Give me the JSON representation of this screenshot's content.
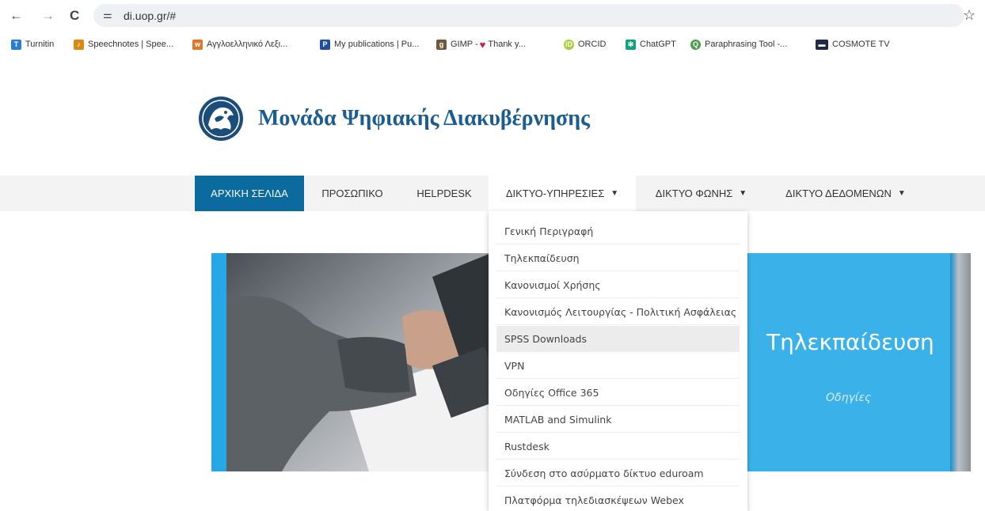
{
  "browser": {
    "url": "di.uop.gr/#",
    "back_icon": "←",
    "forward_icon": "→",
    "reload_icon": "C",
    "site_info_icon": "⚌",
    "star_icon": "☆"
  },
  "bookmarks": [
    {
      "label": "Turnitin",
      "icon": "turnitin-icon",
      "color": "#2b7cd3"
    },
    {
      "label": "Speechnotes | Spee...",
      "icon": "speechnotes-icon",
      "color": "#d98a12"
    },
    {
      "label": "Αγγλοελληνικό Λεξι...",
      "icon": "wordreference-icon",
      "color": "#e0782a"
    },
    {
      "label": "My publications | Pu...",
      "icon": "publons-icon",
      "color": "#1f4e9c"
    },
    {
      "label": "GIMP - ",
      "icon": "gimp-icon",
      "color": "#6e5a3b"
    },
    {
      "label": "Thank y...",
      "icon": "heart-icon",
      "color": "#d11d4b"
    },
    {
      "label": "ORCID",
      "icon": "orcid-icon",
      "color": "#a6ce39"
    },
    {
      "label": "ChatGPT",
      "icon": "chatgpt-icon",
      "color": "#10a37f"
    },
    {
      "label": "Paraphrasing Tool -...",
      "icon": "quillbot-icon",
      "color": "#499e48"
    },
    {
      "label": "COSMOTE TV",
      "icon": "cosmote-icon",
      "color": "#1e2a4a"
    }
  ],
  "site": {
    "title": "Μονάδα Ψηφιακής Διακυβέρνησης"
  },
  "menu": [
    {
      "label": "ΑΡΧΙΚΗ ΣΕΛΙΔΑ",
      "chevron": false,
      "state": "active"
    },
    {
      "label": "ΠΡΟΣΩΠΙΚΟ",
      "chevron": false,
      "state": ""
    },
    {
      "label": "HELPDESK",
      "chevron": false,
      "state": ""
    },
    {
      "label": "ΔΙΚΤΥΟ-ΥΠΗΡΕΣΙΕΣ",
      "chevron": true,
      "state": "open"
    },
    {
      "label": "ΔΙΚΤΥΟ ΦΩΝΗΣ",
      "chevron": true,
      "state": ""
    },
    {
      "label": "ΔΙΚΤΥΟ ΔΕΔΟΜΕΝΩΝ",
      "chevron": true,
      "state": ""
    }
  ],
  "dropdown": [
    "Γενική Περιγραφή",
    "Τηλεκπαίδευση",
    "Κανονισμοί Χρήσης",
    "Κανονισμός Λειτουργίας - Πολιτική Ασφάλειας",
    "SPSS Downloads",
    "VPN",
    "Οδηγίες Office 365",
    "MATLAB and Simulink",
    "Rustdesk",
    "Σύνδεση στο ασύρματο δίκτυο eduroam",
    "Πλατφόρμα τηλεδιασκέψεων Webex"
  ],
  "dropdown_hover_index": 4,
  "hero": {
    "title": "Τηλεκπαίδευση",
    "subtitle": "Οδηγίες"
  },
  "colors": {
    "accent": "#0b6a9e",
    "hero_blue": "#27a8e6",
    "title_blue": "#1c5d91"
  }
}
